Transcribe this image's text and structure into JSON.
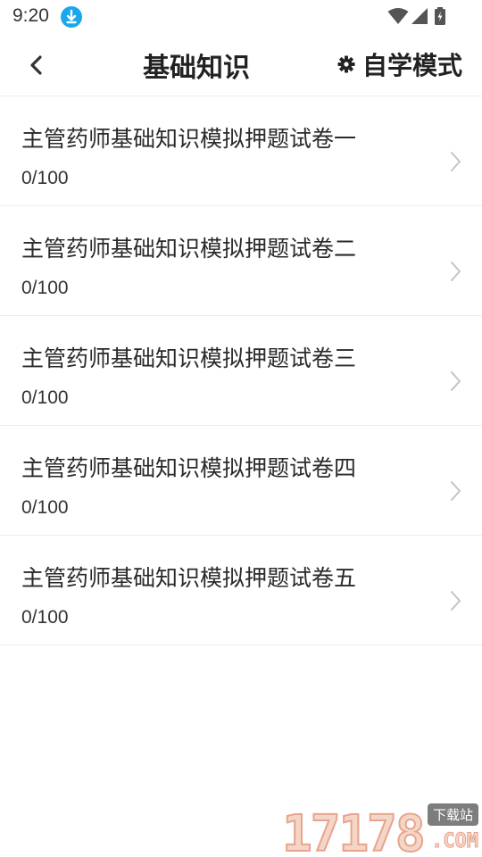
{
  "status_bar": {
    "time": "9:20"
  },
  "header": {
    "title": "基础知识",
    "mode_label": "自学模式"
  },
  "papers": [
    {
      "title": "主管药师基础知识模拟押题试卷一",
      "progress": "0/100"
    },
    {
      "title": "主管药师基础知识模拟押题试卷二",
      "progress": "0/100"
    },
    {
      "title": "主管药师基础知识模拟押题试卷三",
      "progress": "0/100"
    },
    {
      "title": "主管药师基础知识模拟押题试卷四",
      "progress": "0/100"
    },
    {
      "title": "主管药师基础知识模拟押题试卷五",
      "progress": "0/100"
    }
  ],
  "watermark": {
    "digits": "17178",
    "badge": "下载站",
    "suffix": ".COM"
  },
  "colors": {
    "download_badge": "#1aa7ec",
    "divider": "#ececec",
    "chevron": "#c4c4c4"
  }
}
